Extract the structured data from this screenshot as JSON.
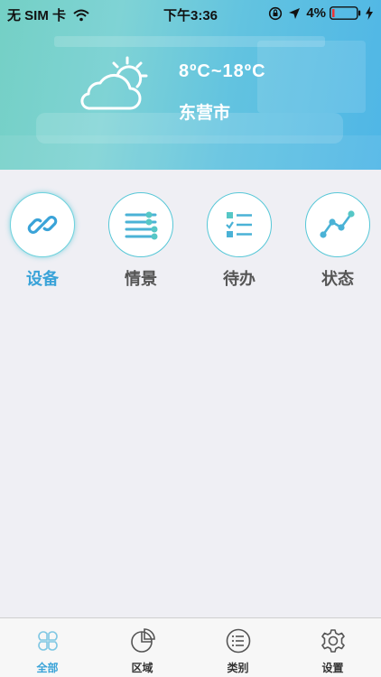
{
  "status_bar": {
    "carrier": "无 SIM 卡",
    "time": "下午3:36",
    "battery_percent": "4%"
  },
  "weather": {
    "temperature_range": "8ºC~18ºC",
    "city": "东营市",
    "icon": "cloud-sun-icon"
  },
  "menu": [
    {
      "label": "设备",
      "icon": "link-icon",
      "active": true
    },
    {
      "label": "情景",
      "icon": "sliders-icon",
      "active": false
    },
    {
      "label": "待办",
      "icon": "checklist-icon",
      "active": false
    },
    {
      "label": "状态",
      "icon": "line-chart-icon",
      "active": false
    }
  ],
  "tabbar": [
    {
      "label": "全部",
      "icon": "clover-icon",
      "active": true
    },
    {
      "label": "区域",
      "icon": "pie-chart-icon",
      "active": false
    },
    {
      "label": "类别",
      "icon": "list-icon",
      "active": false
    },
    {
      "label": "设置",
      "icon": "gear-icon",
      "active": false
    }
  ],
  "colors": {
    "accent": "#3aa3d8",
    "teal": "#56c7d7",
    "background": "#efeff4"
  }
}
